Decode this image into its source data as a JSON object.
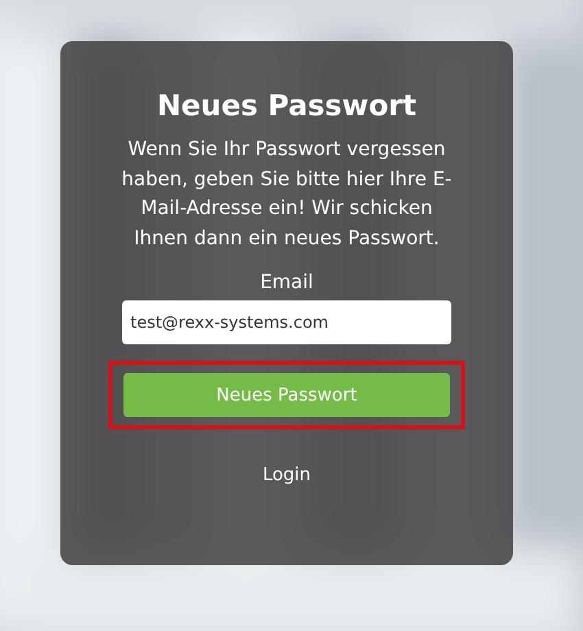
{
  "card": {
    "title": "Neues Passwort",
    "text": "Wenn Sie Ihr Passwort vergessen haben, geben Sie bitte hier Ihre E-Mail-Adresse ein! Wir schicken Ihnen dann ein neues Passwort.",
    "email_label": "Email",
    "email_value": "test@rexx-systems.com",
    "submit_button": {
      "label": "Neues Passwort",
      "highlighted": true
    },
    "login_link": "Login"
  }
}
